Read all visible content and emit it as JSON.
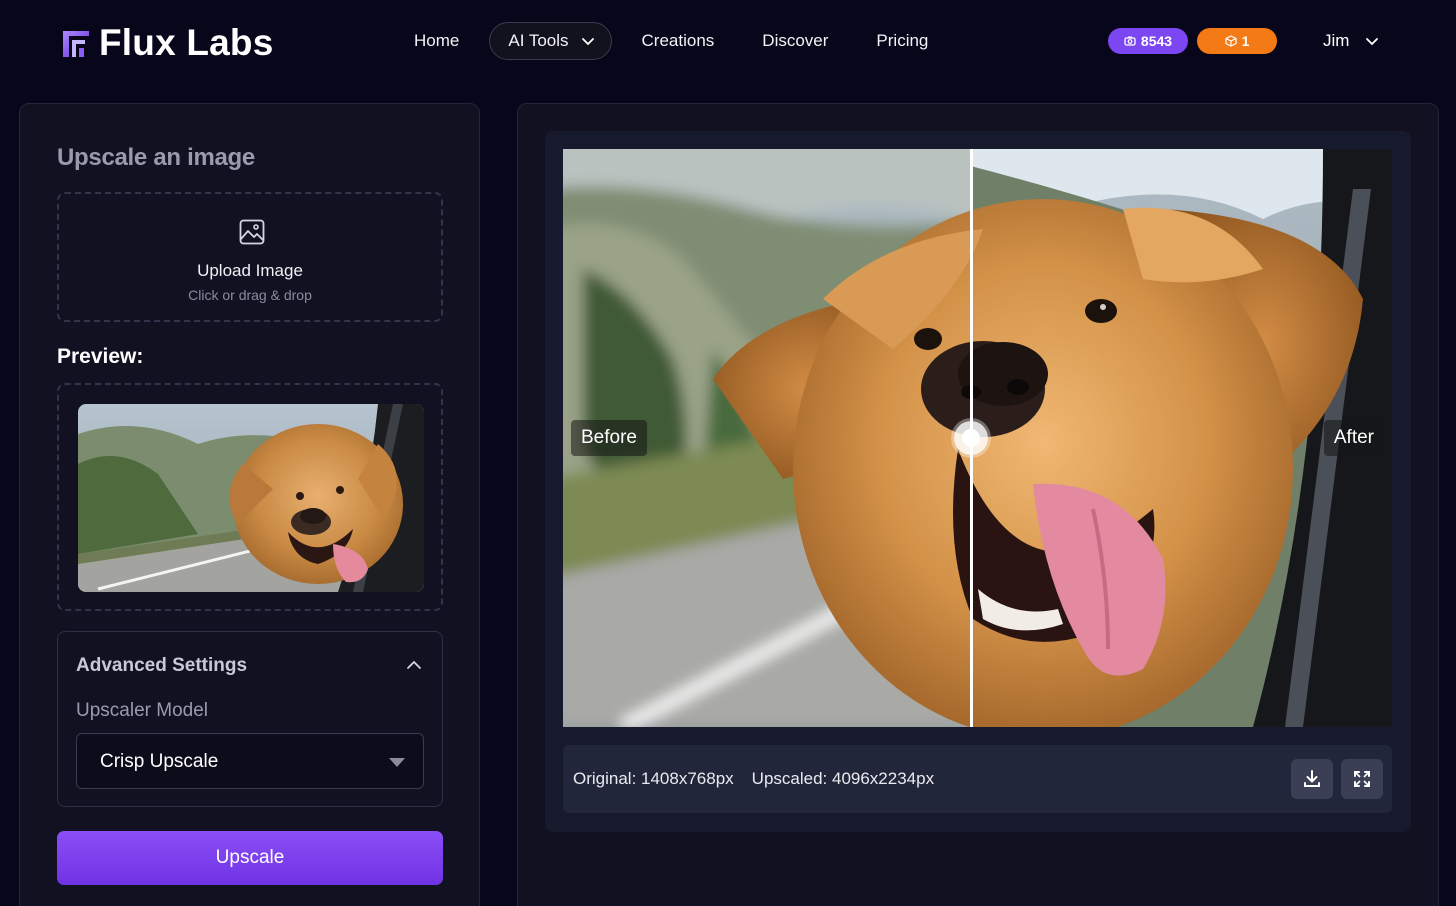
{
  "brand": {
    "name": "Flux Labs",
    "icon": "flux-logo-icon",
    "accent": "#8b5cf6"
  },
  "nav": {
    "items": [
      {
        "label": "Home"
      },
      {
        "label": "AI Tools",
        "icon": "chevron-down-icon"
      },
      {
        "label": "Creations"
      },
      {
        "label": "Discover"
      },
      {
        "label": "Pricing"
      }
    ]
  },
  "badges": {
    "credits": {
      "value": "8543",
      "icon": "camera-icon",
      "color": "#7c46f2"
    },
    "gems": {
      "value": "1",
      "icon": "cube-icon",
      "color": "#f47a16"
    }
  },
  "user": {
    "name": "Jim",
    "icon": "chevron-down-icon"
  },
  "left": {
    "title": "Upscale an image",
    "upload": {
      "icon": "image-icon",
      "title": "Upload Image",
      "subtitle": "Click or drag & drop"
    },
    "preview_label": "Preview:",
    "advanced": {
      "title": "Advanced Settings",
      "icon": "chevron-up-icon",
      "model_label": "Upscaler Model",
      "model_value": "Crisp Upscale"
    },
    "button_label": "Upscale"
  },
  "compare": {
    "before_label": "Before",
    "after_label": "After",
    "original": "Original: 1408x768px",
    "upscaled": "Upscaled: 4096x2234px",
    "download_icon": "download-icon",
    "fullscreen_icon": "fullscreen-icon"
  }
}
